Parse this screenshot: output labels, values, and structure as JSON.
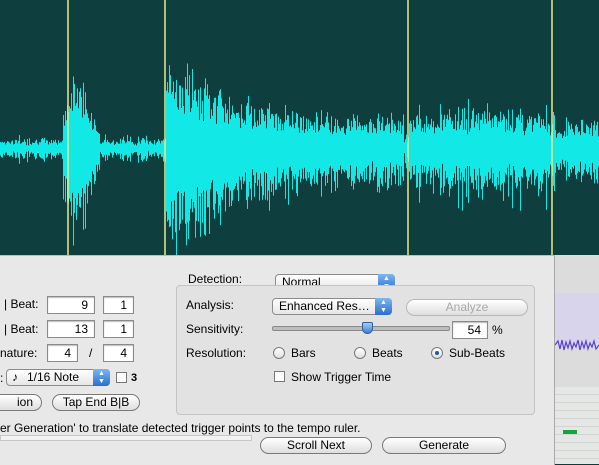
{
  "colors": {
    "waveform": "#12e8e6",
    "background": "#0e3e3e",
    "marker": "#e8ec86"
  },
  "left_panel": {
    "row1_label": "| Beat:",
    "row1_bar": "9",
    "row1_beat": "1",
    "row2_label": "| Beat:",
    "row2_bar": "13",
    "row2_beat": "1",
    "row3_label": "nature:",
    "row3_num": "4",
    "row3_sep": "/",
    "row3_den": "4",
    "row4_label": ":",
    "note_value": "1/16 Note",
    "note_icon": "eighth-note-icon",
    "triplet_label": "3",
    "btn_left": "ion",
    "btn_tap_end": "Tap End B|B"
  },
  "detection": {
    "label": "Detection:",
    "value": "Normal",
    "analysis_label": "Analysis:",
    "analysis_value": "Enhanced Res…",
    "analyze_button": "Analyze",
    "sensitivity_label": "Sensitivity:",
    "sensitivity_value": "54",
    "sensitivity_unit": "%",
    "sensitivity_level": 0.54,
    "resolution_label": "Resolution:",
    "res_bars": "Bars",
    "res_beats": "Beats",
    "res_subbeats": "Sub-Beats",
    "selected_resolution": "Sub-Beats",
    "show_trigger": "Show Trigger Time"
  },
  "footer": {
    "hint": "er Generation' to translate detected trigger points to the tempo ruler.",
    "scroll_next": "Scroll Next",
    "generate": "Generate"
  }
}
